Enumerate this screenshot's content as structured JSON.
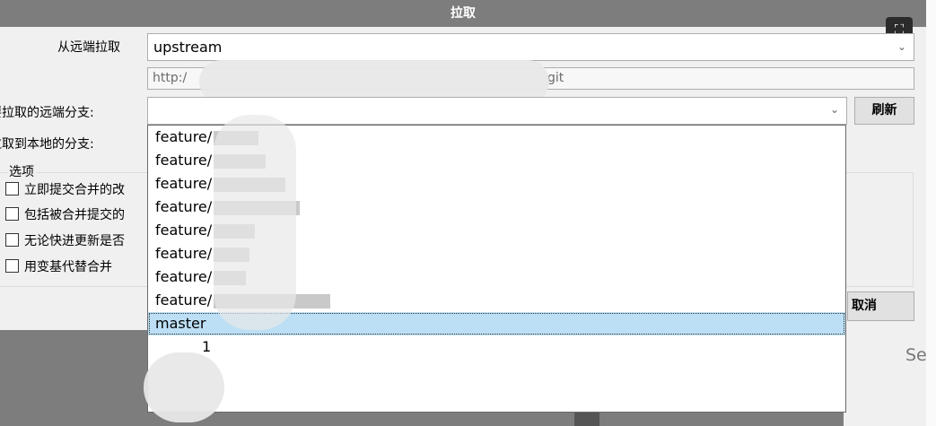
{
  "window": {
    "title": "拉取"
  },
  "form": {
    "remote_label": "从远端拉取",
    "remote_value": "upstream",
    "url_value": "http:/",
    "url_suffix": "git",
    "remote_branch_label": "要拉取的远端分支:",
    "local_branch_label": "拉取到本地的分支:",
    "refresh_label": "刷新",
    "cancel_label": "取消"
  },
  "options": {
    "group_label": "选项",
    "items": [
      {
        "label": "立即提交合并的改",
        "checked": false
      },
      {
        "label": "包括被合并提交的",
        "checked": false
      },
      {
        "label": "无论快进更新是否",
        "checked": false
      },
      {
        "label": "用变基代替合并",
        "checked": false
      }
    ]
  },
  "dropdown": {
    "items": [
      {
        "label": "feature/"
      },
      {
        "label": "feature/"
      },
      {
        "label": "feature/"
      },
      {
        "label": "feature/"
      },
      {
        "label": "feature/"
      },
      {
        "label": "feature/"
      },
      {
        "label": "feature/"
      },
      {
        "label": "feature/"
      },
      {
        "label": "master",
        "selected": true
      },
      {
        "label": "1"
      }
    ]
  },
  "background": {
    "fragment_text": "Se"
  },
  "colors": {
    "title_bg": "#7d7d7d",
    "selection": "#bcdff5"
  }
}
